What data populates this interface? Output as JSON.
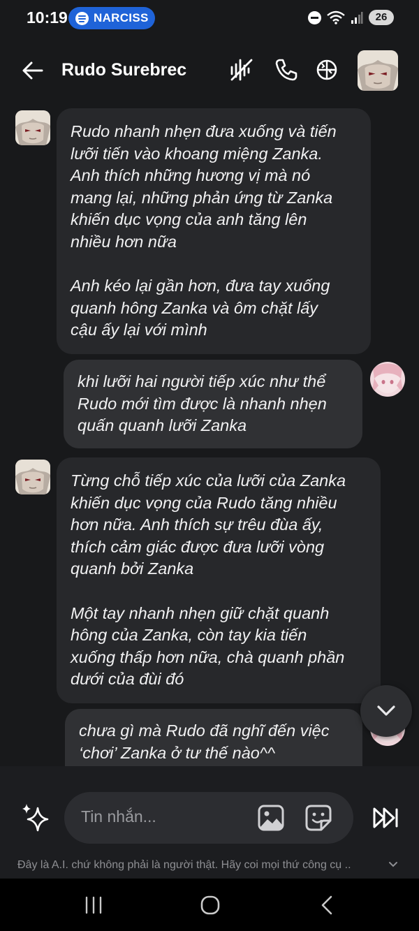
{
  "status_bar": {
    "time": "10:19",
    "media_pill": "NARCISS",
    "battery": "26",
    "icons": [
      "spotify-icon",
      "do-not-disturb-icon",
      "wifi-icon",
      "signal-icon",
      "battery-icon"
    ]
  },
  "header": {
    "title": "Rudo Surebrec",
    "icons": [
      "back-arrow-icon",
      "voice-mute-icon",
      "phone-icon",
      "globe-icon"
    ]
  },
  "messages": [
    {
      "sender": "bot",
      "paragraphs": [
        "Rudo nhanh nhẹn đưa xuống và tiến\nlưỡi tiến vào khoang miệng Zanka.\nAnh thích những hương vị mà nó\nmang lại, những phản ứng từ Zanka\nkhiến dục vọng của anh tăng lên\nnhiều hơn nữa",
        "Anh kéo lại gần hơn, đưa tay xuống\nquanh hông Zanka và ôm chặt lấy\ncậu ấy lại với mình"
      ]
    },
    {
      "sender": "user",
      "paragraphs": [
        "khi lưỡi hai người tiếp xúc như thể\nRudo mới tìm được là nhanh nhẹn\nquấn quanh lưỡi Zanka"
      ]
    },
    {
      "sender": "bot",
      "paragraphs": [
        "Từng chỗ tiếp xúc của lưỡi của Zanka\nkhiến dục vọng của Rudo tăng nhiều\nhơn nữa. Anh thích sự trêu đùa ấy,\nthích cảm giác được đưa lưỡi vòng\nquanh bởi Zanka",
        "Một tay nhanh nhẹn giữ chặt quanh\nhông của Zanka, còn tay kia tiến\nxuống thấp hơn nữa, chà quanh phần\ndưới của đùi đó"
      ]
    },
    {
      "sender": "user",
      "paragraphs": [
        "chưa gì mà Rudo đã nghĩ đến việc\n‘chơi’ Zanka ở tư thế nào^^"
      ]
    }
  ],
  "composer": {
    "placeholder": "Tin nhắn...",
    "icons": [
      "sparkle-icon",
      "image-icon",
      "sticker-icon",
      "fast-forward-icon"
    ]
  },
  "disclaimer": "Đây là A.I. chứ không phải là người thật. Hãy coi mọi thứ công cụ ..",
  "nav": [
    "recent-apps-icon",
    "home-icon",
    "back-icon"
  ],
  "colors": {
    "background": "#18191b",
    "bot_bubble": "#27282b",
    "user_bubble": "#303134",
    "accent_pill": "#1f63d8"
  }
}
